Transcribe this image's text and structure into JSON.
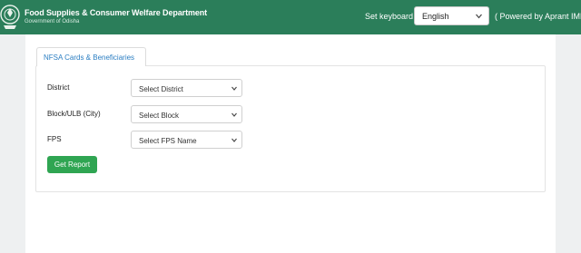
{
  "header": {
    "title": "Food Supplies & Consumer Welfare Department",
    "subtitle": "Government of Odisha",
    "emblem_icon": "state-emblem-icon",
    "keyboard_label": "Set keyboard",
    "language_value": "English",
    "language_icon": "chevron-down-icon",
    "powered_text": "( Powered by Aprant IME"
  },
  "tabs": [
    {
      "label": "NFSA Cards & Beneficiaries",
      "active": true
    }
  ],
  "form": {
    "district": {
      "label": "District",
      "value": "Select District"
    },
    "block": {
      "label": "Block/ULB (City)",
      "value": "Select Block"
    },
    "fps": {
      "label": "FPS",
      "value": "Select FPS Name"
    },
    "submit_label": "Get Report"
  },
  "colors": {
    "header_bg": "#2b7e5a",
    "button_bg": "#2fa552",
    "tab_text": "#2b7ec2",
    "page_bg": "#eef0f1"
  }
}
